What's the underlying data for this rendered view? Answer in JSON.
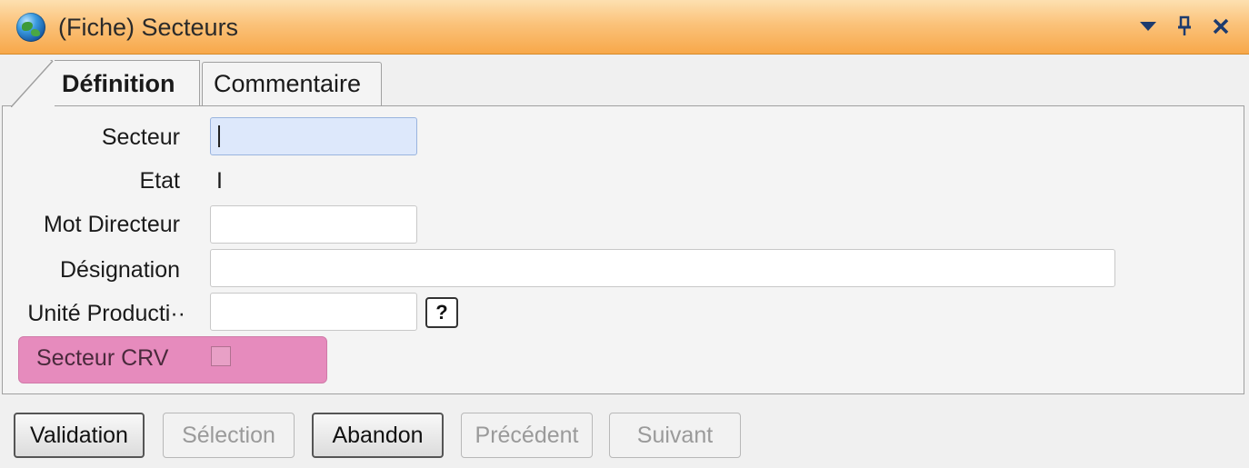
{
  "window": {
    "title": "(Fiche) Secteurs",
    "icon": "globe-icon",
    "controls": [
      "dropdown-icon",
      "pin-icon",
      "close-icon"
    ],
    "close_glyph": "✕",
    "pin_glyph": "ꟷ"
  },
  "tabs": [
    {
      "label": "Définition",
      "active": true
    },
    {
      "label": "Commentaire",
      "active": false
    }
  ],
  "form": {
    "secteur_label": "Secteur",
    "secteur_value": "",
    "etat_label": "Etat",
    "etat_value": "I",
    "mot_directeur_label": "Mot Directeur",
    "mot_directeur_value": "",
    "designation_label": "Désignation",
    "designation_value": "",
    "unite_production_label": "Unité Producti··",
    "unite_production_value": "",
    "help_label": "?",
    "secteur_crv_label": "Secteur CRV",
    "secteur_crv_checked": false,
    "highlight_color": "#e68bbd"
  },
  "buttons": {
    "validation": "Validation",
    "selection": "Sélection",
    "abandon": "Abandon",
    "precedent": "Précédent",
    "suivant": "Suivant"
  },
  "colors": {
    "titlebar": "#f7a84a",
    "focus_field": "#dde8fb"
  }
}
